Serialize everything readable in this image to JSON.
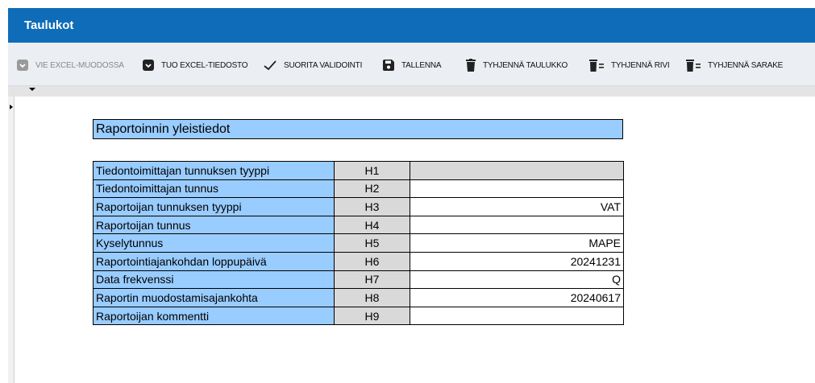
{
  "window": {
    "title": "Taulukot"
  },
  "toolbar": {
    "export_excel": "VIE EXCEL-MUODOSSA",
    "import_excel": "TUO EXCEL-TIEDOSTO",
    "validate": "SUORITA VALIDOINTI",
    "save": "TALLENNA",
    "clear_table": "TYHJENNÄ TAULUKKO",
    "clear_row": "TYHJENNÄ RIVI",
    "clear_column": "TYHJENNÄ SARAKE"
  },
  "sheet": {
    "header": "Raportoinnin yleistiedot",
    "rows": [
      {
        "label": "Tiedontoimittajan tunnuksen tyyppi",
        "code": "H1",
        "value": ""
      },
      {
        "label": "Tiedontoimittajan tunnus",
        "code": "H2",
        "value": ""
      },
      {
        "label": "Raportoijan tunnuksen tyyppi",
        "code": "H3",
        "value": "VAT"
      },
      {
        "label": "Raportoijan tunnus",
        "code": "H4",
        "value": ""
      },
      {
        "label": "Kyselytunnus",
        "code": "H5",
        "value": "MAPE"
      },
      {
        "label": "Raportointiajankohdan loppupäivä",
        "code": "H6",
        "value": "20241231"
      },
      {
        "label": "Data frekvenssi",
        "code": "H7",
        "value": "Q"
      },
      {
        "label": "Raportin muodostamisajankohta",
        "code": "H8",
        "value": "20240617"
      },
      {
        "label": "Raportoijan kommentti",
        "code": "H9",
        "value": ""
      }
    ]
  },
  "colors": {
    "title_bar": "#0e6cb8",
    "label_cell": "#99ccff",
    "code_cell": "#d9d9d9",
    "toolbar_bg": "#ebeef2"
  },
  "icons": [
    "export-icon",
    "import-icon",
    "checkmark-icon",
    "save-icon",
    "trash-icon",
    "delete-row-icon",
    "delete-column-icon"
  ]
}
